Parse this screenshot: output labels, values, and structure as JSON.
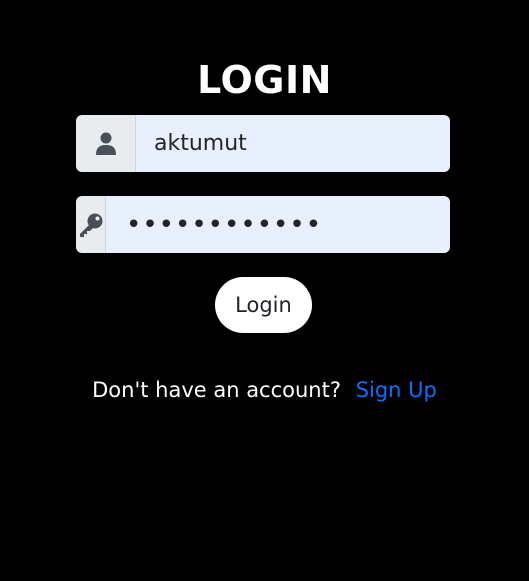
{
  "header": {
    "title": "LOGIN"
  },
  "form": {
    "username": {
      "icon": "user-icon",
      "value": "aktumut"
    },
    "password": {
      "icon": "key-icon",
      "value": "aktumut12345"
    },
    "submit_label": "Login"
  },
  "footer": {
    "prompt": "Don't have an account?",
    "signup_label": "Sign Up"
  },
  "colors": {
    "background": "#000000",
    "addon_bg": "#e9ecef",
    "field_bg": "#e8f0fe",
    "icon": "#495057",
    "link": "#0d6efd"
  }
}
